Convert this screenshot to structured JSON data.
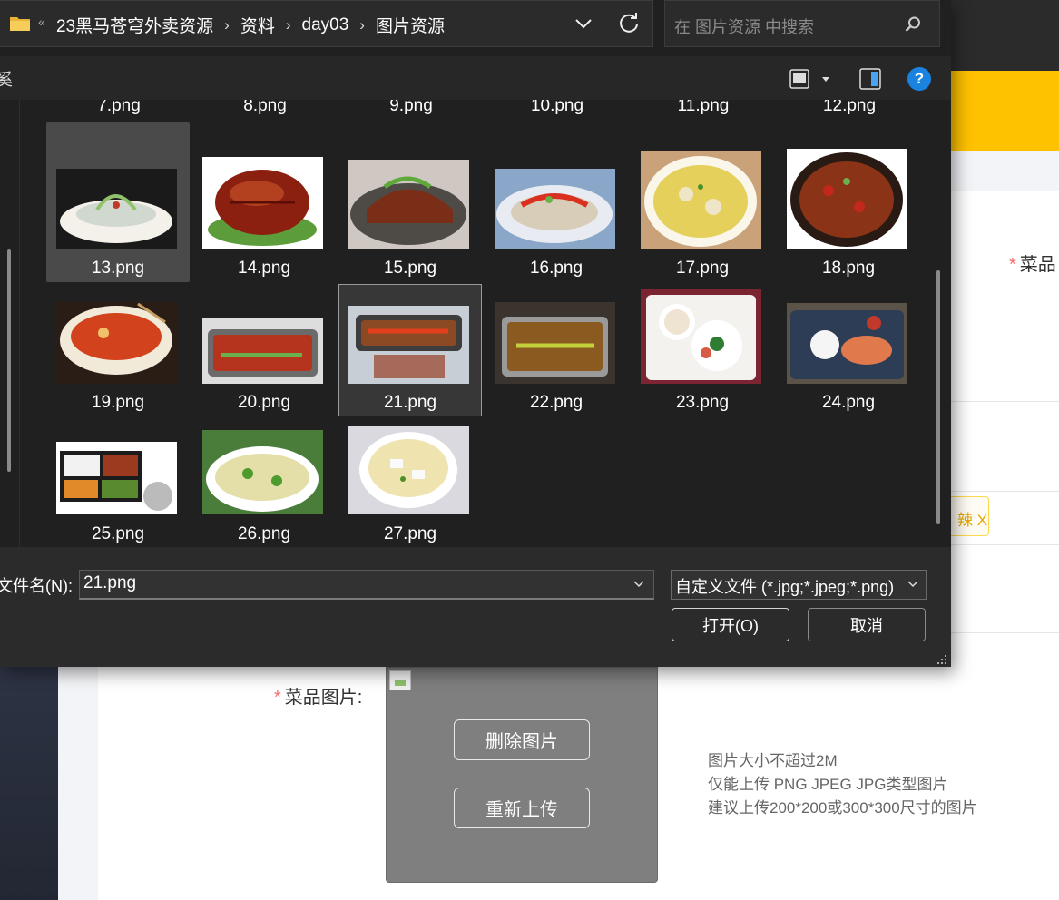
{
  "background": {
    "dish_label": "菜品",
    "required_mark": "*",
    "chip_text": "辣 X",
    "image_label": "菜品图片:",
    "delete_button": "删除图片",
    "reupload_button": "重新上传",
    "hints": [
      "图片大小不超过2M",
      "仅能上传 PNG JPEG JPG类型图片",
      "建议上传200*200或300*300尺寸的图片"
    ]
  },
  "dialog": {
    "breadcrumb_overflow": "«",
    "breadcrumbs": [
      "23黑马苍穹外卖资源",
      "资料",
      "day03",
      "图片资源"
    ],
    "search_placeholder": "在 图片资源 中搜索",
    "toolbar_cut_text": "奚",
    "help_label": "?",
    "partial_row": [
      "7.png",
      "8.png",
      "9.png",
      "10.png",
      "11.png",
      "12.png"
    ],
    "files": [
      {
        "name": "13.png",
        "state": "hover"
      },
      {
        "name": "14.png"
      },
      {
        "name": "15.png"
      },
      {
        "name": "16.png"
      },
      {
        "name": "17.png"
      },
      {
        "name": "18.png"
      },
      {
        "name": "19.png"
      },
      {
        "name": "20.png"
      },
      {
        "name": "21.png",
        "state": "selected"
      },
      {
        "name": "22.png"
      },
      {
        "name": "23.png"
      },
      {
        "name": "24.png"
      },
      {
        "name": "25.png"
      },
      {
        "name": "26.png"
      },
      {
        "name": "27.png"
      }
    ],
    "filename_label": "文件名(N):",
    "filename_value": "21.png",
    "filetype_value": "自定义文件 (*.jpg;*.jpeg;*.png)",
    "open_button": "打开(O)",
    "cancel_button": "取消"
  },
  "colors": {
    "accent_yellow": "#ffc200",
    "dialog_bg": "#202020",
    "help_blue": "#1a83e0",
    "required_red": "#f56c6c"
  }
}
